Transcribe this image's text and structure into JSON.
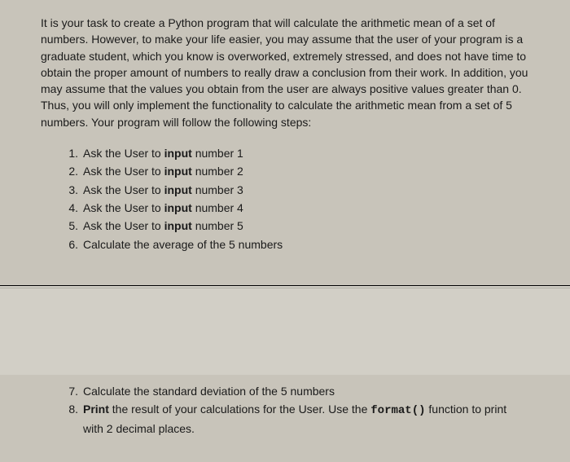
{
  "intro": "It is your task to create a Python program that will calculate the arithmetic mean of a set of numbers. However, to make your life easier, you may assume that the user of your program is a graduate student, which you know is overworked, extremely stressed, and does not have time to obtain the proper amount of numbers to really draw a conclusion from their work. In addition, you may assume that the values you obtain from the user are always positive values greater than 0. Thus, you will only implement the functionality to calculate the arithmetic mean from a set of 5 numbers. Your program will follow the following steps:",
  "steps_upper": [
    {
      "num": "1.",
      "pre": "Ask the User to ",
      "bold": "input",
      "post": " number 1"
    },
    {
      "num": "2.",
      "pre": "Ask the User to ",
      "bold": "input",
      "post": " number 2"
    },
    {
      "num": "3.",
      "pre": "Ask the User to ",
      "bold": "input",
      "post": " number 3"
    },
    {
      "num": "4.",
      "pre": "Ask the User to ",
      "bold": "input",
      "post": " number 4"
    },
    {
      "num": "5.",
      "pre": "Ask the User to ",
      "bold": "input",
      "post": " number 5"
    },
    {
      "num": "6.",
      "pre": "Calculate the average of the 5 numbers",
      "bold": "",
      "post": ""
    }
  ],
  "steps_lower": {
    "step7": {
      "num": "7.",
      "text": "Calculate the standard deviation of the 5 numbers"
    },
    "step8": {
      "num": "8.",
      "bold1": "Print",
      "mid1": " the result of your calculations for the User. Use the ",
      "mono": "format()",
      "mid2": " function to print",
      "cont": "with 2 decimal places."
    }
  }
}
